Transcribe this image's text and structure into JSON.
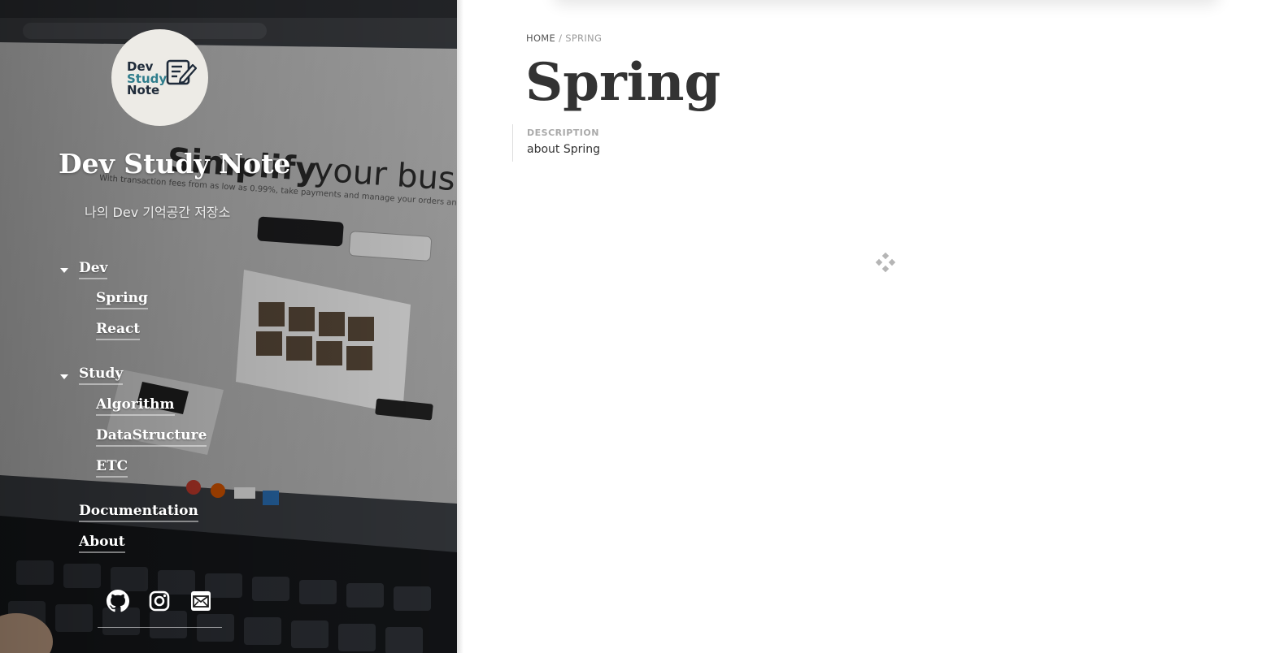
{
  "sidebar": {
    "logo": {
      "line1": "Dev",
      "line2": "Study",
      "line3": "Note"
    },
    "title": "Dev Study Note",
    "subtitle": "나의 Dev 기억공간 저장소",
    "nav": {
      "dev": {
        "label": "Dev",
        "children": [
          "Spring",
          "React"
        ]
      },
      "study": {
        "label": "Study",
        "children": [
          "Algorithm",
          "DataStructure",
          "ETC"
        ]
      },
      "documentation": "Documentation",
      "about": "About"
    },
    "social_icons": [
      "github-icon",
      "instagram-icon",
      "mail-icon"
    ]
  },
  "main": {
    "breadcrumb": {
      "home": "HOME",
      "separator": "/",
      "current": "SPRING"
    },
    "title": "Spring",
    "description": {
      "label": "DESCRIPTION",
      "text": "about Spring"
    }
  },
  "colors": {
    "title_text": "#333333",
    "muted": "#9b9b9b",
    "sidebar_text": "#ffffff"
  }
}
